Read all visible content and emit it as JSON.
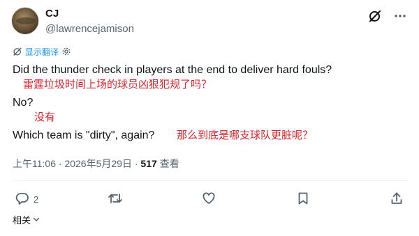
{
  "author": {
    "name": "CJ",
    "handle": "@lawrencejamison"
  },
  "translate_label": "显示翻译",
  "tweet": {
    "line1": "Did the thunder check in players at the end to deliver hard fouls?",
    "line1_translation": "雷霆垃圾时间上场的球员凶狠犯规了吗？",
    "line2": "No?",
    "line2_translation": "没有",
    "line3": "Which team is \"dirty\", again?",
    "line3_translation": "那么到底是哪支球队更脏呢？"
  },
  "meta": {
    "time": "上午11:06",
    "separator1": "·",
    "date": "2026年5月29日",
    "separator2": "·",
    "views_count": "517",
    "views_label": "查看"
  },
  "actions": {
    "reply_count": "2"
  },
  "related_label": "相关",
  "colors": {
    "accent": "#1d9bf0",
    "translation_red": "#e0242b",
    "secondary_text": "#536471"
  }
}
